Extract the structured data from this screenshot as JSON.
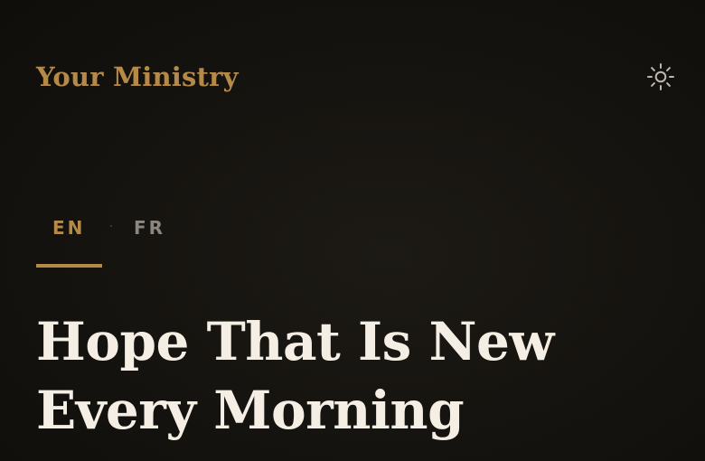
{
  "header": {
    "brand": "Your Ministry",
    "theme_toggle_icon": "sun-icon"
  },
  "language": {
    "options": [
      "EN",
      "FR"
    ],
    "selected": "EN",
    "separator": "·"
  },
  "hero": {
    "title_line1": "Hope That Is New",
    "title_line2": "Every Morning"
  },
  "colors": {
    "accent": "#b58a48",
    "background": "#15130f",
    "title": "#f4eee4",
    "muted": "#8c8680"
  }
}
